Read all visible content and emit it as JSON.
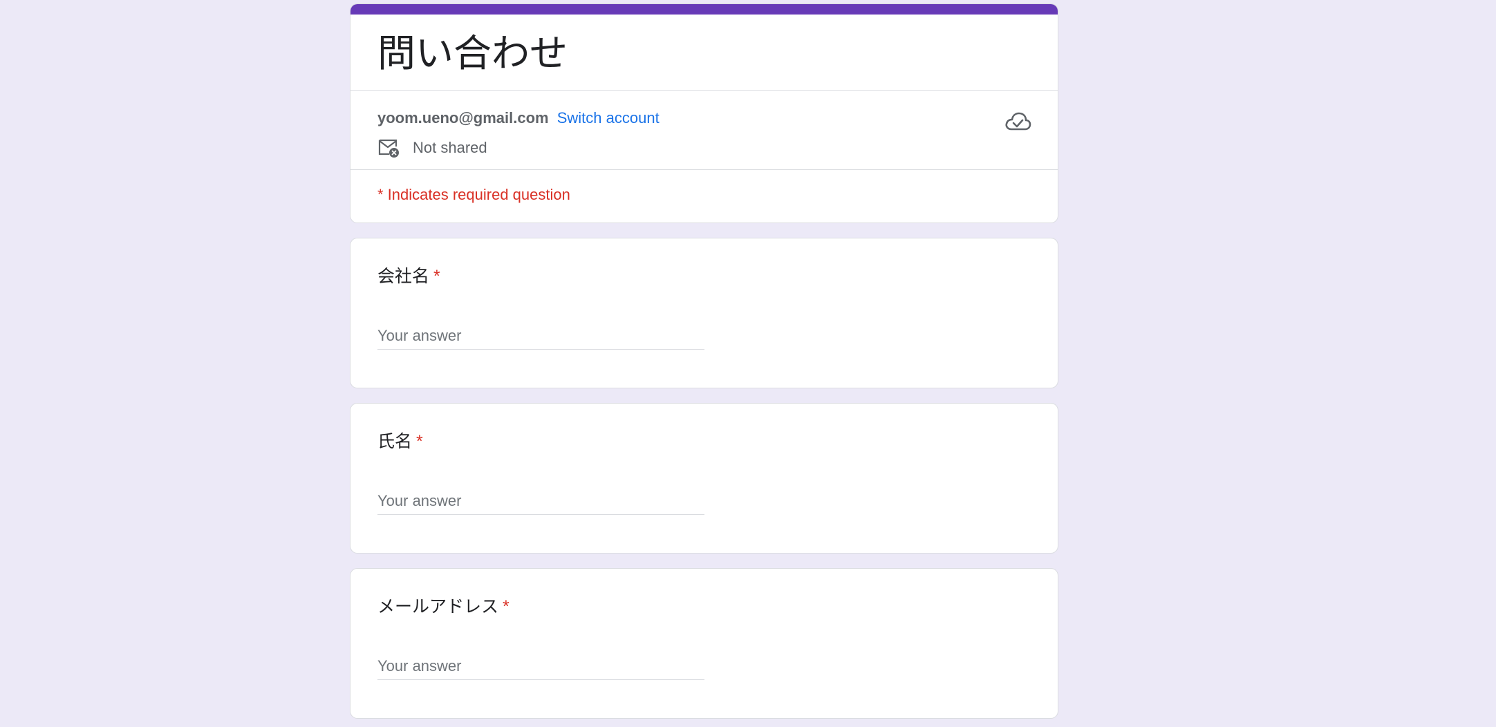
{
  "form": {
    "title": "問い合わせ",
    "accent_color": "#673ab7"
  },
  "account": {
    "email": "yoom.ueno@gmail.com",
    "switch_label": "Switch account",
    "shared_status": "Not shared",
    "mail_icon": "mail-off-icon",
    "save_status_icon": "cloud-done-icon"
  },
  "required_note": "* Indicates required question",
  "questions": [
    {
      "label": "会社名",
      "required_mark": "*",
      "placeholder": "Your answer",
      "value": ""
    },
    {
      "label": "氏名",
      "required_mark": "*",
      "placeholder": "Your answer",
      "value": ""
    },
    {
      "label": "メールアドレス",
      "required_mark": "*",
      "placeholder": "Your answer",
      "value": ""
    }
  ]
}
